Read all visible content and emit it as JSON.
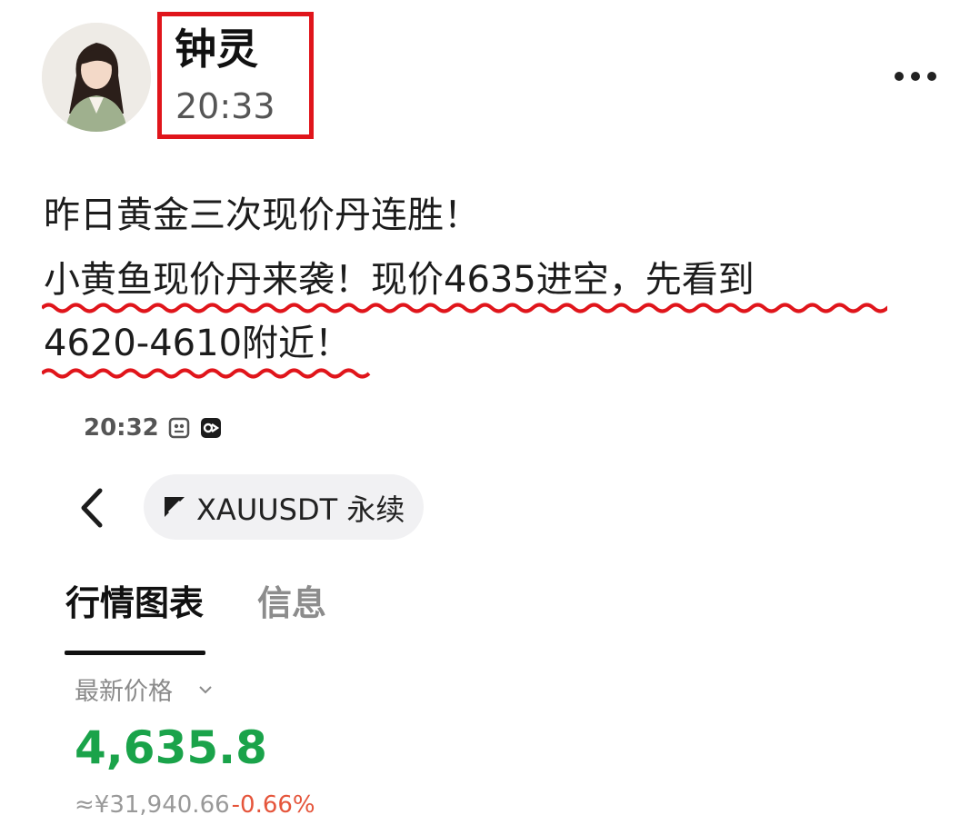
{
  "post": {
    "author": "钟灵",
    "time": "20:33",
    "lines": [
      "昨日黄金三次现价丹连胜！",
      "小黄鱼现价丹来袭！现价4635进空，先看到",
      "4620-4610附近！"
    ]
  },
  "screenshot": {
    "status_time": "20:32",
    "symbol": "XAUUSDT 永续",
    "tabs": [
      {
        "label": "行情图表",
        "active": true
      },
      {
        "label": "信息",
        "active": false
      }
    ],
    "price_label": "最新价格",
    "price": "4,635.8",
    "price_color": "#1aa34a",
    "cny_price": "≈¥31,940.66",
    "change_pct": "-0.66%",
    "change_color": "#e5553b"
  },
  "colors": {
    "highlight_box": "#e0151b",
    "squiggle": "#e0151b"
  },
  "icons": [
    "more-options-icon",
    "back-chevron-icon",
    "symbol-icon",
    "dropdown-chevron-icon",
    "status-app-icon",
    "status-notification-icon"
  ]
}
